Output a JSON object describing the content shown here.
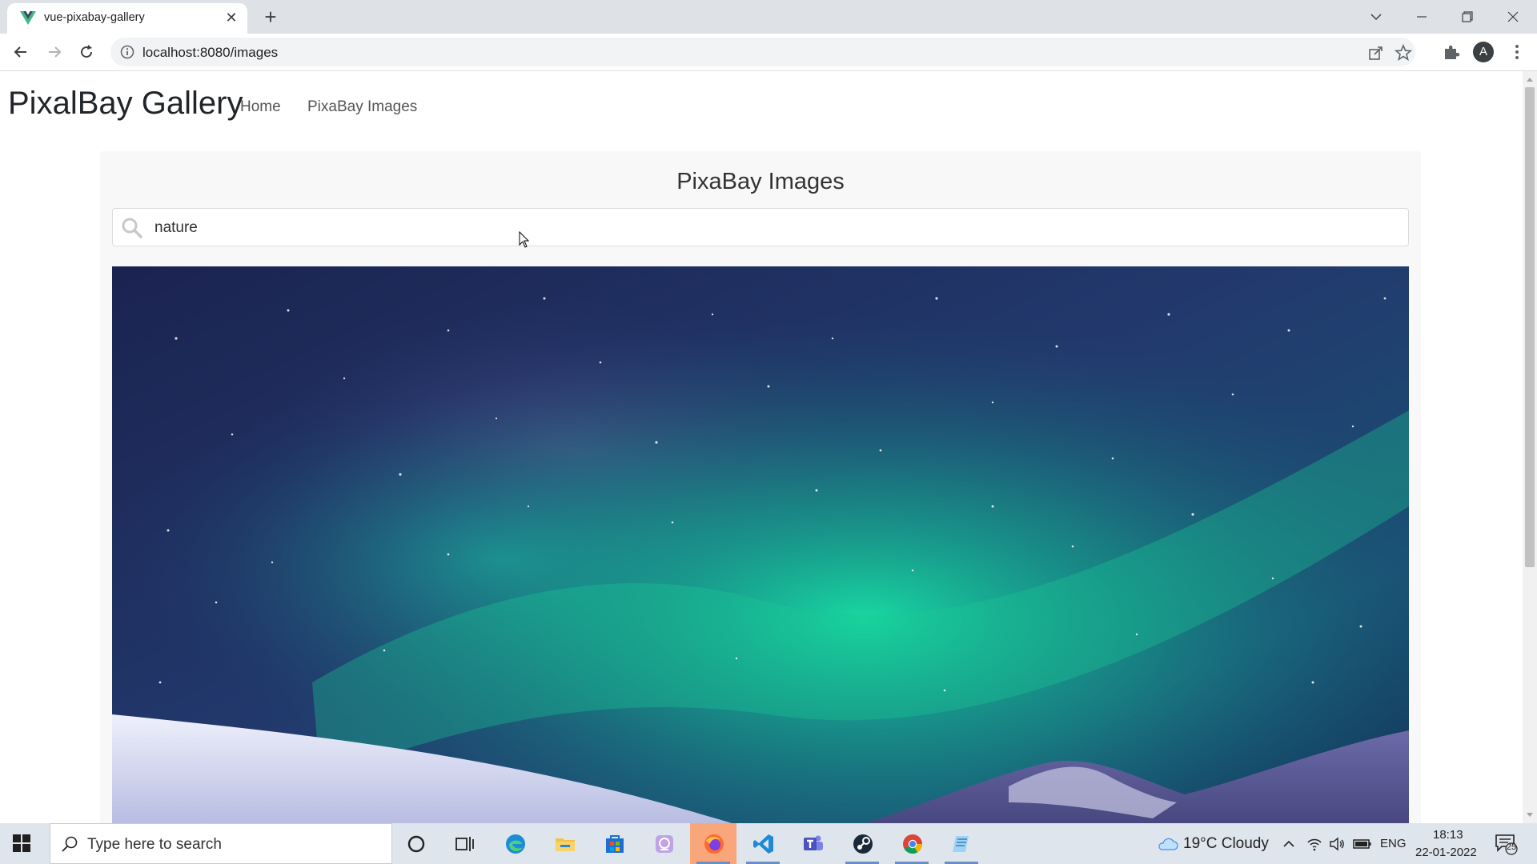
{
  "browser": {
    "tab_title": "vue-pixabay-gallery",
    "tab_close": "✕",
    "new_tab": "+",
    "url": "localhost:8080/images",
    "profile_initial": "A"
  },
  "navbar": {
    "brand": "PixalBay Gallery",
    "links": [
      "Home",
      "PixaBay Images"
    ]
  },
  "gallery": {
    "title": "PixaBay Images",
    "search_value": "nature"
  },
  "taskbar": {
    "search_placeholder": "Type here to search",
    "weather": "19°C  Cloudy",
    "language": "ENG",
    "time": "18:13",
    "date": "22-01-2022",
    "notification_count": "25"
  }
}
